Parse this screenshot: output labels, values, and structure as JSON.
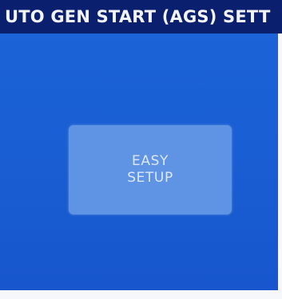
{
  "header": {
    "title": "UTO GEN START (AGS) SETT"
  },
  "main": {
    "easy_setup_button": {
      "line1": "EASY",
      "line2": "SETUP"
    }
  },
  "colors": {
    "title_bar_background": "#0a1f6e",
    "title_text": "#f2f4fa",
    "panel_background": "#1a5ed4",
    "button_background": "#5f93e4",
    "button_text": "#dde8fa"
  }
}
